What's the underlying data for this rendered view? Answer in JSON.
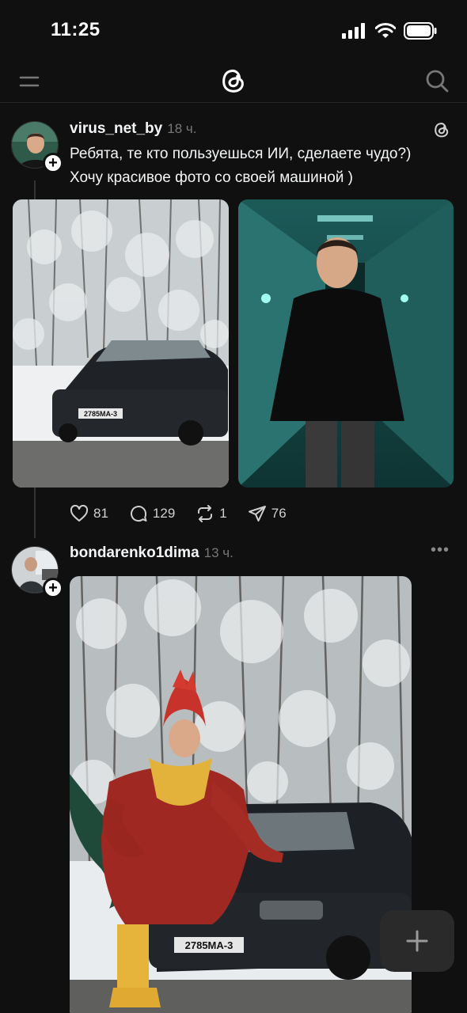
{
  "status_bar": {
    "time": "11:25"
  },
  "nav": {
    "logo_icon": "threads-logo-icon",
    "menu_icon": "menu-icon",
    "search_icon": "search-icon"
  },
  "posts": [
    {
      "username": "virus_net_by",
      "time": "18 ч.",
      "text_line1": "Ребята, те кто пользуешься ИИ, сделаете чудо?)",
      "text_line2": "Хочу красивое фото со своей машиной )",
      "actions": {
        "likes": "81",
        "replies": "129",
        "reposts": "1",
        "shares": "76"
      }
    },
    {
      "username": "bondarenko1dima",
      "time": "13 ч."
    }
  ],
  "plate_text": "2785MA-3",
  "colors": {
    "background": "#101010",
    "text": "#f3f5f7",
    "muted": "#777777",
    "fab": "#2a2a2a"
  }
}
